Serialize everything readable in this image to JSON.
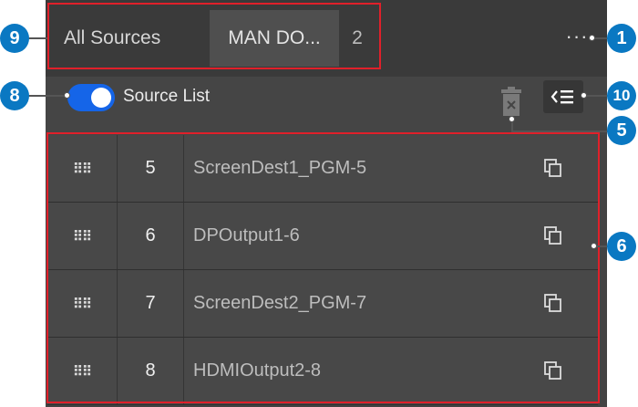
{
  "tabs": {
    "all_sources": "All Sources",
    "active": "MAN DO...",
    "count": "2",
    "more_icon": "more-horizontal-icon"
  },
  "source_list": {
    "toggle_on": true,
    "label": "Source List",
    "delete_icon": "trash-icon",
    "list_icon": "list-collapse-icon"
  },
  "rows": [
    {
      "index": "5",
      "name": "ScreenDest1_PGM-5"
    },
    {
      "index": "6",
      "name": "DPOutput1-6"
    },
    {
      "index": "7",
      "name": "ScreenDest2_PGM-7"
    },
    {
      "index": "8",
      "name": "HDMIOutput2-8"
    }
  ],
  "callouts": {
    "c1": "1",
    "c5": "5",
    "c6": "6",
    "c8": "8",
    "c9": "9",
    "c10": "10"
  },
  "colors": {
    "callout": "#0a78c2",
    "highlight": "#e0202a",
    "toggle": "#1565e8"
  }
}
